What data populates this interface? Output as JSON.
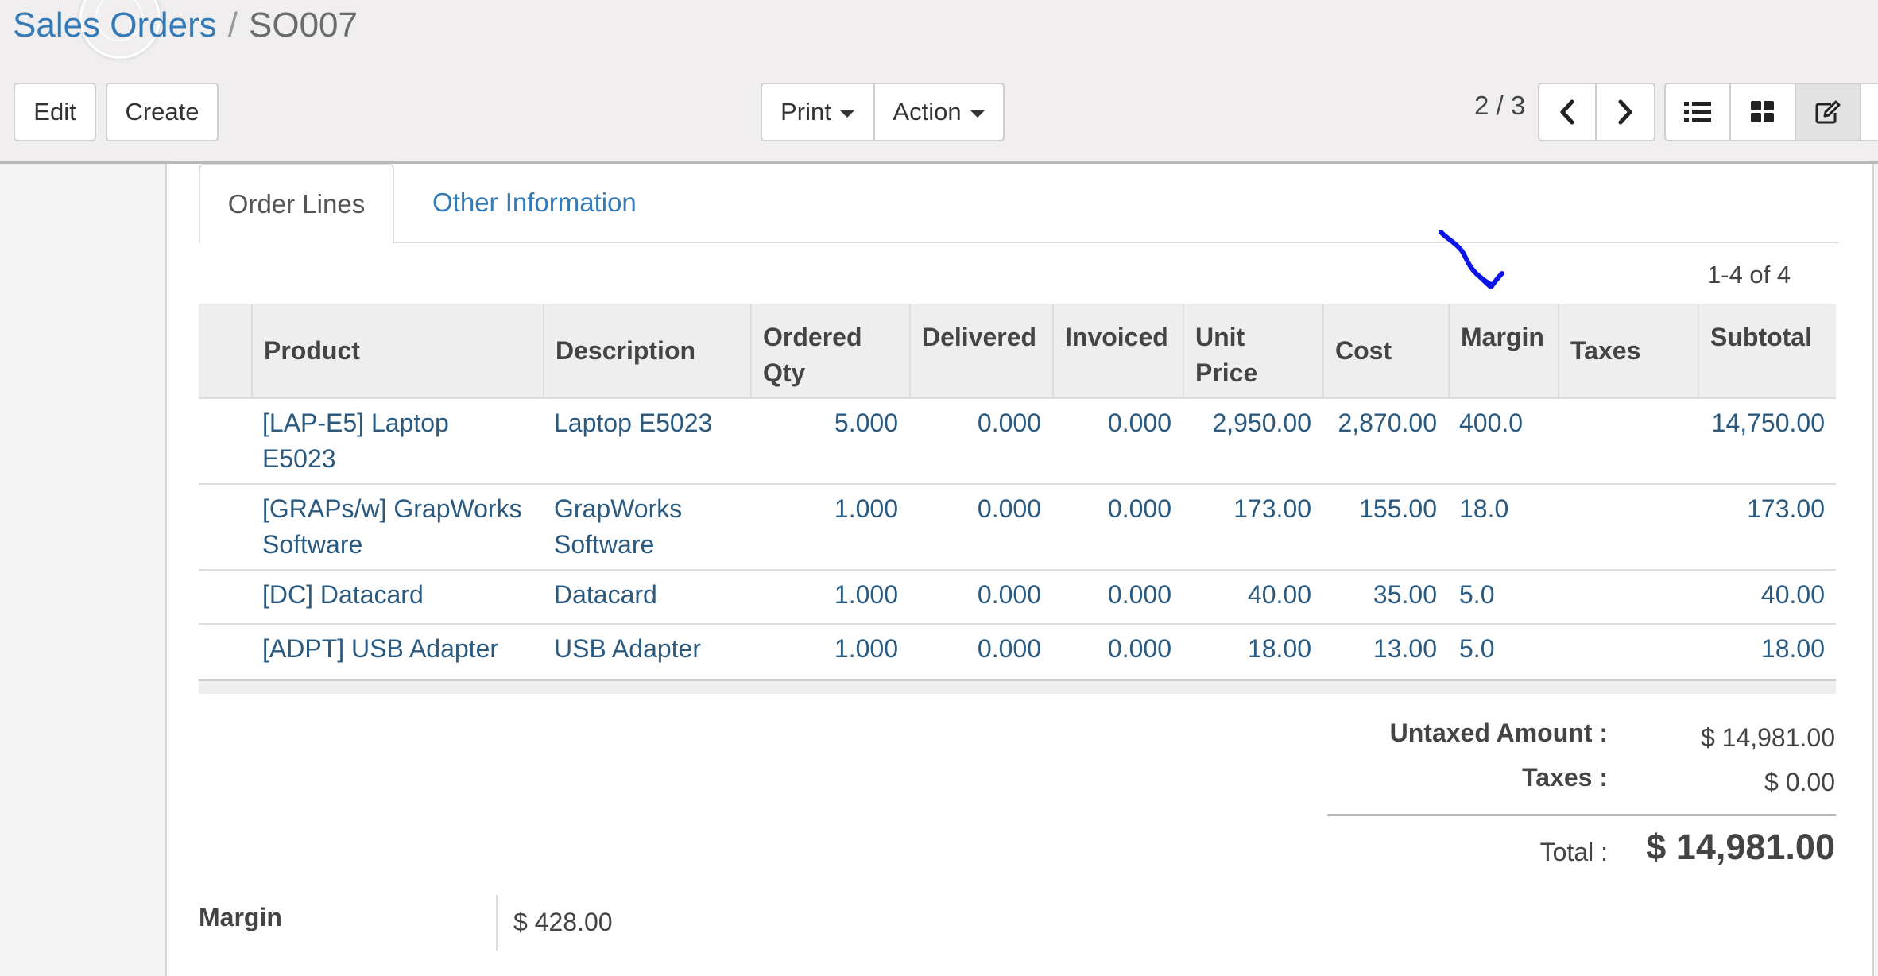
{
  "breadcrumb": {
    "parent": "Sales Orders",
    "separator": "/",
    "current": "SO007"
  },
  "toolbar": {
    "edit": "Edit",
    "create": "Create",
    "print": "Print",
    "action": "Action"
  },
  "pager": {
    "value": "2 / 3"
  },
  "view_switcher": [
    "list-view",
    "kanban-view",
    "form-view"
  ],
  "tabs": [
    {
      "label": "Order Lines",
      "active": true
    },
    {
      "label": "Other Information",
      "active": false
    }
  ],
  "records_counter": "1-4 of 4",
  "columns": [
    "Product",
    "Description",
    "Ordered Qty",
    "Delivered",
    "Invoiced",
    "Unit Price",
    "Cost",
    "Margin",
    "Taxes",
    "Subtotal"
  ],
  "rows": [
    {
      "product": "[LAP-E5] Laptop E5023",
      "description": "Laptop E5023",
      "ordered_qty": "5.000",
      "delivered": "0.000",
      "invoiced": "0.000",
      "unit_price": "2,950.00",
      "cost": "2,870.00",
      "margin": "400.0",
      "taxes": "",
      "subtotal": "14,750.00"
    },
    {
      "product": "[GRAPs/w] GrapWorks Software",
      "description": "GrapWorks Software",
      "ordered_qty": "1.000",
      "delivered": "0.000",
      "invoiced": "0.000",
      "unit_price": "173.00",
      "cost": "155.00",
      "margin": "18.0",
      "taxes": "",
      "subtotal": "173.00"
    },
    {
      "product": "[DC] Datacard",
      "description": "Datacard",
      "ordered_qty": "1.000",
      "delivered": "0.000",
      "invoiced": "0.000",
      "unit_price": "40.00",
      "cost": "35.00",
      "margin": "5.0",
      "taxes": "",
      "subtotal": "40.00"
    },
    {
      "product": "[ADPT] USB Adapter",
      "description": "USB Adapter",
      "ordered_qty": "1.000",
      "delivered": "0.000",
      "invoiced": "0.000",
      "unit_price": "18.00",
      "cost": "13.00",
      "margin": "5.0",
      "taxes": "",
      "subtotal": "18.00"
    }
  ],
  "totals": {
    "untaxed_label": "Untaxed Amount :",
    "untaxed_value": "$ 14,981.00",
    "taxes_label": "Taxes :",
    "taxes_value": "$ 0.00",
    "total_label": "Total :",
    "total_value": "$ 14,981.00"
  },
  "margin_field": {
    "label": "Margin",
    "value": "$ 428.00"
  },
  "colors": {
    "link": "#337ab7",
    "cell_text": "#2b5a80",
    "annotation": "#0a14e6",
    "header_bg": "#eeeeee"
  }
}
